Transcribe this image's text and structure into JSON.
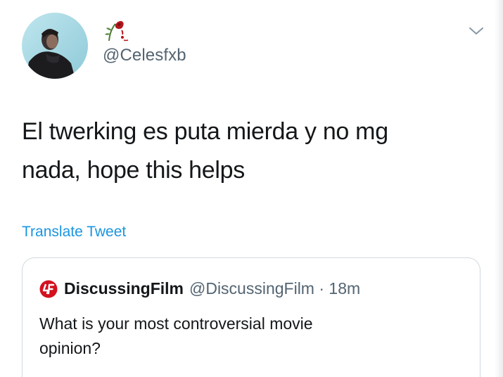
{
  "author": {
    "display_name_icon": "wilted-rose-icon",
    "handle": "@Celesfxb",
    "avatar_icon": "profile-photo"
  },
  "menu_icon": "chevron-down-icon",
  "tweet": {
    "text_line1": "El twerking es puta mierda y no mg",
    "text_line2": "nada, hope this helps",
    "translate_label": "Translate Tweet"
  },
  "quoted_tweet": {
    "logo_icon": "discussingfilm-logo-icon",
    "name": "DiscussingFilm",
    "meta": "@DiscussingFilm · 18m",
    "text_line1": "What is your most controversial movie",
    "text_line2": "opinion?"
  },
  "colors": {
    "text": "#14171a",
    "secondary": "#536471",
    "link": "#1b95e0",
    "border": "#cfd9de",
    "logo_red": "#d3121f"
  }
}
